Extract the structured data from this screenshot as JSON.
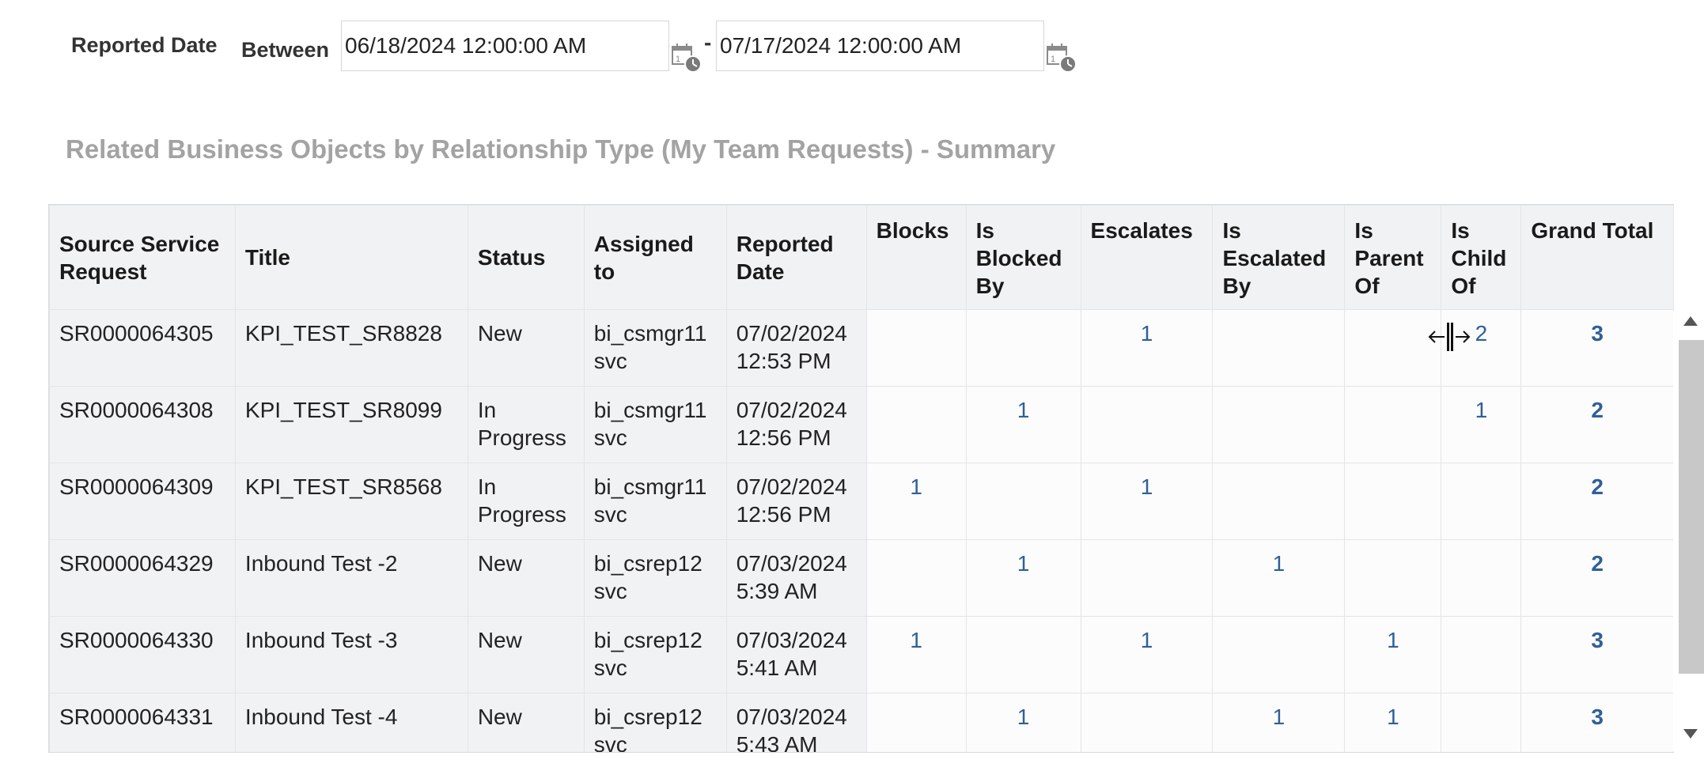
{
  "filter": {
    "field_label": "Reported Date",
    "operator_label": "Between",
    "date_from": "06/18/2024 12:00:00 AM",
    "separator": "-",
    "date_to": "07/17/2024 12:00:00 AM"
  },
  "report": {
    "title": "Related Business Objects by Relationship Type (My Team Requests) - Summary"
  },
  "table": {
    "headers": {
      "source": "Source Service Request",
      "title": "Title",
      "status": "Status",
      "assigned": "Assigned to",
      "reported": "Reported Date",
      "blocks": "Blocks",
      "blocked_by": "Is Blocked By",
      "escalates": "Escalates",
      "escalated_by": "Is Escalated By",
      "parent_of": "Is Parent Of",
      "child_of": "Is Child Of",
      "grand_total": "Grand Total"
    },
    "rows": [
      {
        "source": "SR0000064305",
        "title": "KPI_TEST_SR8828",
        "status": "New",
        "assigned": "bi_csmgr11 svc",
        "reported": "07/02/2024 12:53 PM",
        "blocks": "",
        "blocked_by": "",
        "escalates": "1",
        "escalated_by": "",
        "parent_of": "",
        "child_of": "2",
        "grand_total": "3"
      },
      {
        "source": "SR0000064308",
        "title": "KPI_TEST_SR8099",
        "status": "In Progress",
        "assigned": "bi_csmgr11 svc",
        "reported": "07/02/2024 12:56 PM",
        "blocks": "",
        "blocked_by": "1",
        "escalates": "",
        "escalated_by": "",
        "parent_of": "",
        "child_of": "1",
        "grand_total": "2"
      },
      {
        "source": "SR0000064309",
        "title": "KPI_TEST_SR8568",
        "status": "In Progress",
        "assigned": "bi_csmgr11 svc",
        "reported": "07/02/2024 12:56 PM",
        "blocks": "1",
        "blocked_by": "",
        "escalates": "1",
        "escalated_by": "",
        "parent_of": "",
        "child_of": "",
        "grand_total": "2"
      },
      {
        "source": "SR0000064329",
        "title": "Inbound Test -2",
        "status": "New",
        "assigned": "bi_csrep12 svc",
        "reported": "07/03/2024 5:39 AM",
        "blocks": "",
        "blocked_by": "1",
        "escalates": "",
        "escalated_by": "1",
        "parent_of": "",
        "child_of": "",
        "grand_total": "2"
      },
      {
        "source": "SR0000064330",
        "title": "Inbound Test -3",
        "status": "New",
        "assigned": "bi_csrep12 svc",
        "reported": "07/03/2024 5:41 AM",
        "blocks": "1",
        "blocked_by": "",
        "escalates": "1",
        "escalated_by": "",
        "parent_of": "1",
        "child_of": "",
        "grand_total": "3"
      },
      {
        "source": "SR0000064331",
        "title": "Inbound Test -4",
        "status": "New",
        "assigned": "bi_csrep12 svc",
        "reported": "07/03/2024 5:43 AM",
        "blocks": "",
        "blocked_by": "1",
        "escalates": "",
        "escalated_by": "1",
        "parent_of": "1",
        "child_of": "",
        "grand_total": "3"
      }
    ]
  },
  "icons": {
    "date_picker": "calendar-clock-icon",
    "cursor": "column-resize-cursor-icon"
  },
  "colors": {
    "link": "#2f5f98",
    "title": "#a3a3a3",
    "header_bg": "#f1f2f4"
  }
}
